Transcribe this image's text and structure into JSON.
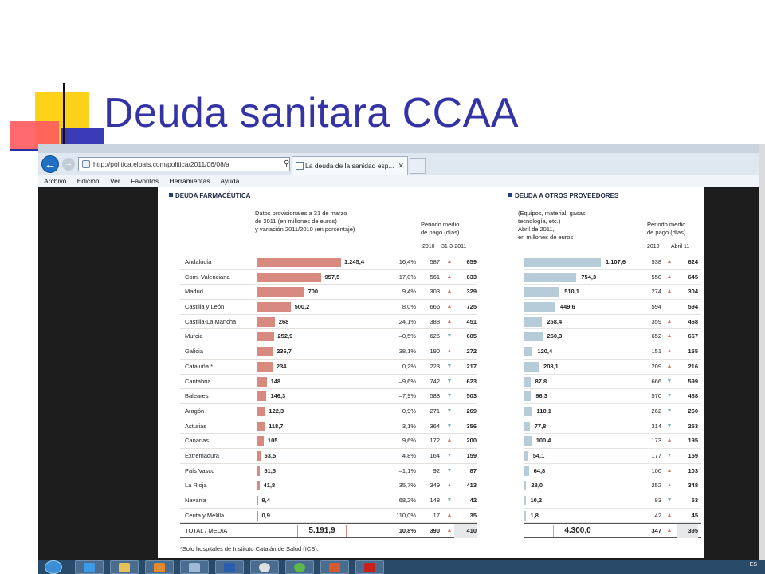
{
  "slide": {
    "title": "Deuda sanitara CCAA"
  },
  "browser": {
    "window_title": "",
    "url": "http://politica.elpais.com/politica/2011/06/08/a",
    "tab_label": "La deuda de la sanidad esp...",
    "menu": [
      "Archivo",
      "Edición",
      "Ver",
      "Favoritos",
      "Herramientas",
      "Ayuda"
    ]
  },
  "pharma": {
    "title": "DEUDA FARMACÉUTICA",
    "note_lines": [
      "Datos provisionales a 31 de marzo",
      "de 2011 (en millones de euros)",
      "y variación 2011/2010 (en porcentaje)"
    ],
    "period_lines": [
      "Periodo medio",
      "de pago (días)"
    ],
    "col_2010": "2010",
    "col_2011": "31-3-2011",
    "max_value": 1245.4,
    "rows": [
      {
        "name": "Andalucía",
        "value": 1245.4,
        "value_label": "1.245,4",
        "pct": "16,4%",
        "p2010": "587",
        "trend": "up",
        "p2011": "659"
      },
      {
        "name": "Com. Valenciana",
        "value": 957.5,
        "value_label": "957,5",
        "pct": "17,0%",
        "p2010": "561",
        "trend": "up",
        "p2011": "633"
      },
      {
        "name": "Madrid",
        "value": 700,
        "value_label": "700",
        "pct": "9,4%",
        "p2010": "303",
        "trend": "up",
        "p2011": "329"
      },
      {
        "name": "Castilla y León",
        "value": 500.2,
        "value_label": "500,2",
        "pct": "8,0%",
        "p2010": "666",
        "trend": "up",
        "p2011": "725"
      },
      {
        "name": "Castilla-La Mancha",
        "value": 268,
        "value_label": "268",
        "pct": "24,1%",
        "p2010": "388",
        "trend": "up",
        "p2011": "451"
      },
      {
        "name": "Murcia",
        "value": 252.9,
        "value_label": "252,9",
        "pct": "–0,5%",
        "p2010": "625",
        "trend": "down",
        "p2011": "605"
      },
      {
        "name": "Galicia",
        "value": 236.7,
        "value_label": "236,7",
        "pct": "38,1%",
        "p2010": "190",
        "trend": "up",
        "p2011": "272"
      },
      {
        "name": "Cataluña *",
        "value": 234,
        "value_label": "234",
        "pct": "0,2%",
        "p2010": "223",
        "trend": "down",
        "p2011": "217"
      },
      {
        "name": "Cantabria",
        "value": 148,
        "value_label": "148",
        "pct": "–9,6%",
        "p2010": "742",
        "trend": "down",
        "p2011": "623"
      },
      {
        "name": "Baleares",
        "value": 146.3,
        "value_label": "146,3",
        "pct": "–7,9%",
        "p2010": "588",
        "trend": "down",
        "p2011": "503"
      },
      {
        "name": "Aragón",
        "value": 122.3,
        "value_label": "122,3",
        "pct": "0,9%",
        "p2010": "271",
        "trend": "down",
        "p2011": "269"
      },
      {
        "name": "Asturias",
        "value": 118.7,
        "value_label": "118,7",
        "pct": "3,1%",
        "p2010": "364",
        "trend": "down",
        "p2011": "356"
      },
      {
        "name": "Canarias",
        "value": 105,
        "value_label": "105",
        "pct": "9,6%",
        "p2010": "172",
        "trend": "up",
        "p2011": "200"
      },
      {
        "name": "Extremadura",
        "value": 53.5,
        "value_label": "53,5",
        "pct": "4,8%",
        "p2010": "164",
        "trend": "down",
        "p2011": "159"
      },
      {
        "name": "País Vasco",
        "value": 51.5,
        "value_label": "51,5",
        "pct": "–1,1%",
        "p2010": "92",
        "trend": "down",
        "p2011": "87"
      },
      {
        "name": "La Rioja",
        "value": 41.8,
        "value_label": "41,8",
        "pct": "35,7%",
        "p2010": "349",
        "trend": "up",
        "p2011": "413"
      },
      {
        "name": "Navarra",
        "value": 9.4,
        "value_label": "9,4",
        "pct": "–68,2%",
        "p2010": "148",
        "trend": "down",
        "p2011": "42"
      },
      {
        "name": "Ceuta y Melilla",
        "value": 0.9,
        "value_label": "0,9",
        "pct": "110,0%",
        "p2010": "17",
        "trend": "up",
        "p2011": "35"
      }
    ],
    "total": {
      "name": "TOTAL / MEDIA",
      "value_label": "5.191,9",
      "pct": "10,8%",
      "p2010": "390",
      "trend": "up",
      "p2011": "410"
    }
  },
  "providers": {
    "title": "DEUDA A OTROS PROVEEDORES",
    "note_lines": [
      "(Equipos, material, gasas,",
      "tecnología, etc.)",
      "Abril de 2011,",
      "en millones de euros"
    ],
    "period_lines": [
      "Periodo medio",
      "de pago (días)"
    ],
    "col_2010": "2010",
    "col_2011": "Abril 11",
    "max_value": 1107.6,
    "rows": [
      {
        "value": 1107.6,
        "value_label": "1.107,6",
        "p2010": "538",
        "trend": "up",
        "p2011": "624"
      },
      {
        "value": 754.3,
        "value_label": "754,3",
        "p2010": "550",
        "trend": "up",
        "p2011": "645"
      },
      {
        "value": 510.1,
        "value_label": "510,1",
        "p2010": "274",
        "trend": "up",
        "p2011": "304"
      },
      {
        "value": 449.6,
        "value_label": "449,6",
        "p2010": "594",
        "trend": "none",
        "p2011": "594"
      },
      {
        "value": 258.4,
        "value_label": "258,4",
        "p2010": "359",
        "trend": "up",
        "p2011": "468"
      },
      {
        "value": 260.3,
        "value_label": "260,3",
        "p2010": "652",
        "trend": "up",
        "p2011": "667"
      },
      {
        "value": 120.4,
        "value_label": "120,4",
        "p2010": "151",
        "trend": "up",
        "p2011": "155"
      },
      {
        "value": 208.1,
        "value_label": "208,1",
        "p2010": "209",
        "trend": "up",
        "p2011": "216"
      },
      {
        "value": 87.8,
        "value_label": "87,8",
        "p2010": "666",
        "trend": "down",
        "p2011": "599"
      },
      {
        "value": 96.3,
        "value_label": "96,3",
        "p2010": "570",
        "trend": "down",
        "p2011": "488"
      },
      {
        "value": 110.1,
        "value_label": "110,1",
        "p2010": "262",
        "trend": "down",
        "p2011": "260"
      },
      {
        "value": 77.8,
        "value_label": "77,8",
        "p2010": "314",
        "trend": "down",
        "p2011": "253"
      },
      {
        "value": 100.4,
        "value_label": "100,4",
        "p2010": "173",
        "trend": "up",
        "p2011": "195"
      },
      {
        "value": 54.1,
        "value_label": "54,1",
        "p2010": "177",
        "trend": "down",
        "p2011": "159"
      },
      {
        "value": 64.8,
        "value_label": "64,8",
        "p2010": "100",
        "trend": "up",
        "p2011": "103"
      },
      {
        "value": 28.0,
        "value_label": "28,0",
        "p2010": "252",
        "trend": "up",
        "p2011": "348"
      },
      {
        "value": 10.2,
        "value_label": "10,2",
        "p2010": "83",
        "trend": "down",
        "p2011": "53"
      },
      {
        "value": 1.8,
        "value_label": "1,8",
        "p2010": "42",
        "trend": "up",
        "p2011": "45"
      }
    ],
    "total": {
      "value_label": "4.300,0",
      "p2010": "347",
      "trend": "up",
      "p2011": "395"
    }
  },
  "footnote": "*Solo hospitales de Instituto Catalán de Salud (ICS).",
  "taskbar": {
    "lang": "ES"
  },
  "colors": {
    "title": "#3333a6",
    "pharma_bar": "#d98a80",
    "providers_bar": "#b6cdd9",
    "arrow_up": "#d4786c",
    "arrow_down": "#86acc0"
  }
}
